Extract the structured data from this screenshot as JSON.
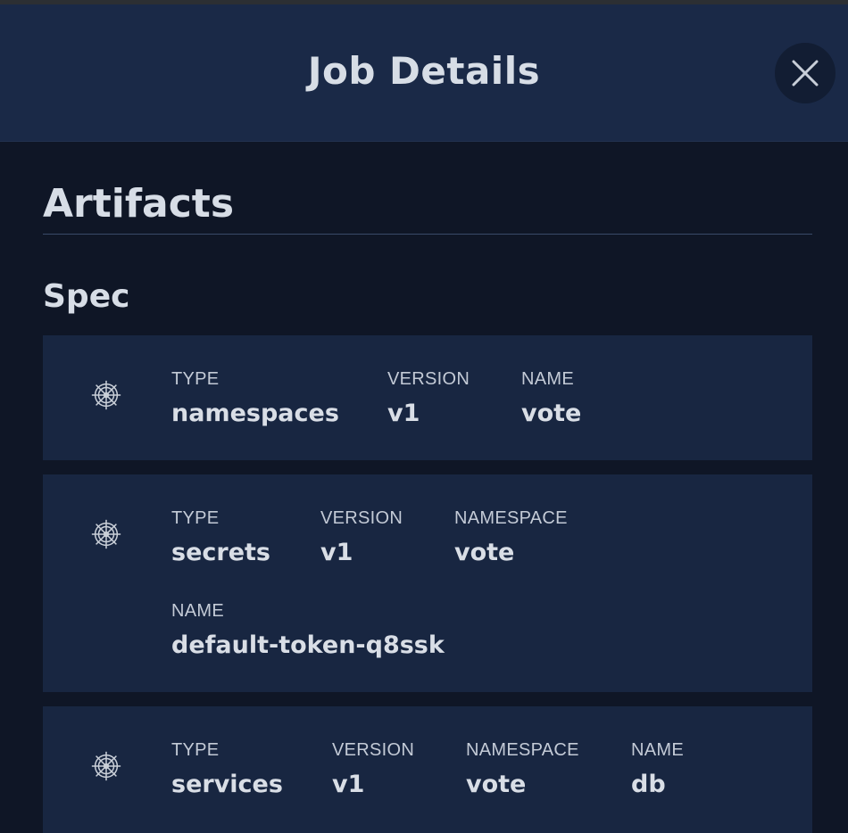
{
  "header": {
    "title": "Job Details"
  },
  "artifacts": {
    "title": "Artifacts",
    "spec": {
      "title": "Spec",
      "items": [
        {
          "icon": "helm-wheel-icon",
          "fields": [
            {
              "label": "TYPE",
              "value": "namespaces"
            },
            {
              "label": "VERSION",
              "value": "v1"
            },
            {
              "label": "NAME",
              "value": "vote"
            }
          ]
        },
        {
          "icon": "helm-wheel-icon",
          "fields": [
            {
              "label": "TYPE",
              "value": "secrets"
            },
            {
              "label": "VERSION",
              "value": "v1"
            },
            {
              "label": "NAMESPACE",
              "value": "vote"
            },
            {
              "label": "NAME",
              "value": "default-token-q8ssk"
            }
          ]
        },
        {
          "icon": "helm-wheel-icon",
          "fields": [
            {
              "label": "TYPE",
              "value": "services"
            },
            {
              "label": "VERSION",
              "value": "v1"
            },
            {
              "label": "NAMESPACE",
              "value": "vote"
            },
            {
              "label": "NAME",
              "value": "db"
            }
          ]
        }
      ]
    }
  }
}
